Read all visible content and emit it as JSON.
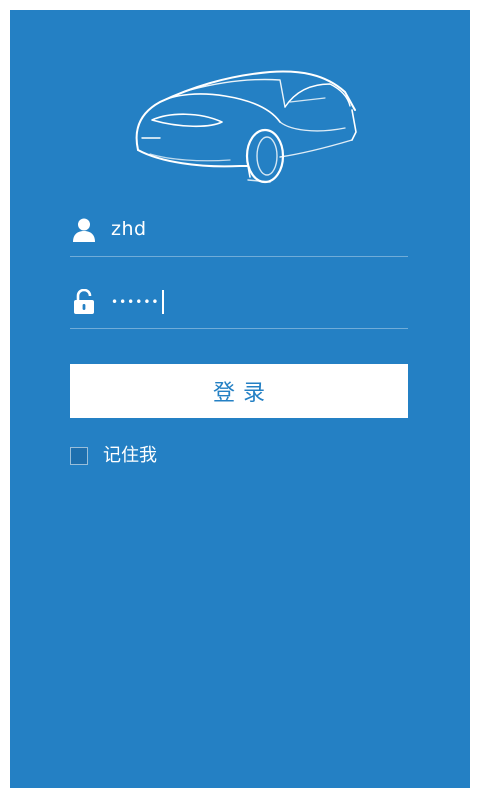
{
  "login": {
    "username_value": "zhd",
    "password_mask": "••••••",
    "submit_label": "登录",
    "remember_label": "记住我",
    "remember_checked": false
  },
  "colors": {
    "background": "#2480C4",
    "button_background": "#FFFFFF",
    "button_text": "#2480C4"
  },
  "icons": {
    "logo": "car-outline-logo",
    "username": "user-icon",
    "password": "lock-icon"
  }
}
